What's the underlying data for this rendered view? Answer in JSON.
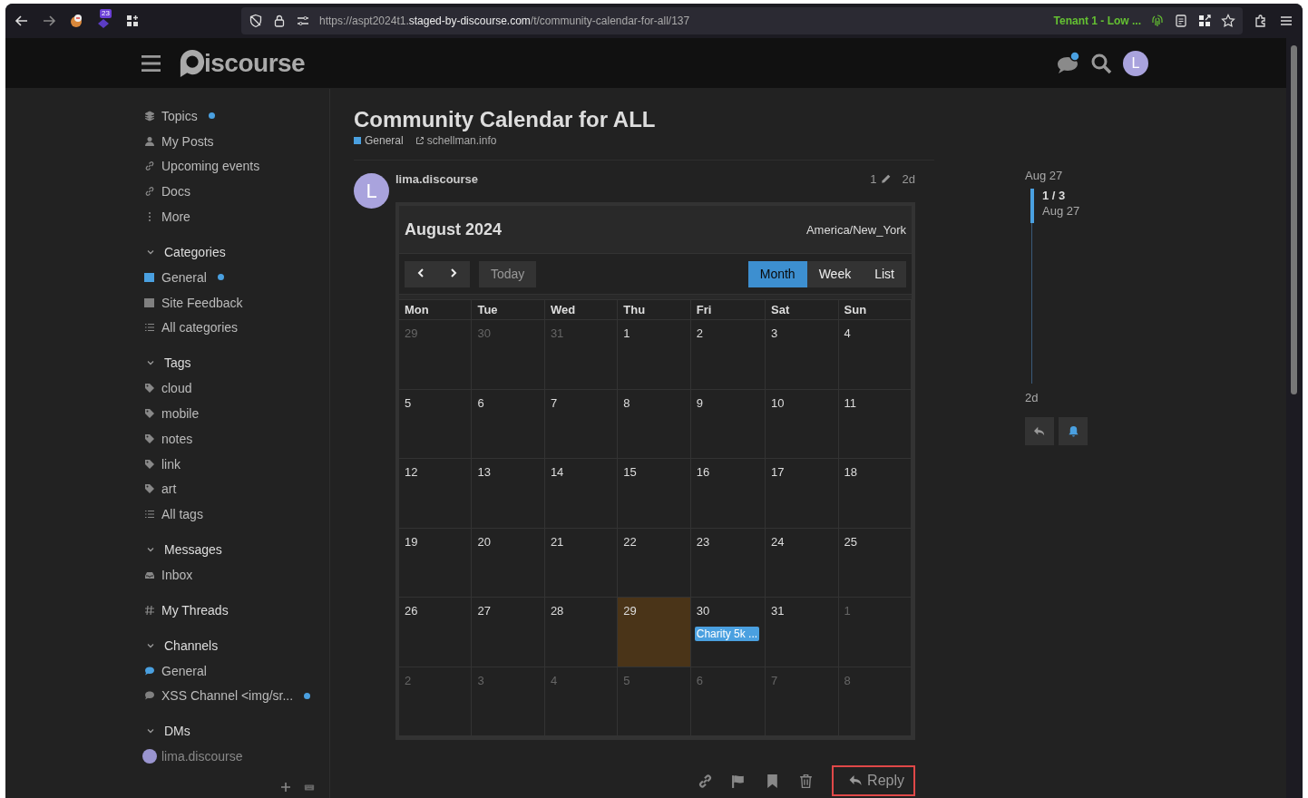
{
  "browser": {
    "url_start": "https://aspt2024t1.",
    "url_host": "staged-by-discourse.com",
    "url_path": "/t/community-calendar-for-all/137",
    "extension_badge": "23",
    "container_label": "Tenant 1 - Low ..."
  },
  "header": {
    "logo_text": "iscourse",
    "chat_unread": true,
    "avatar_letter": "L"
  },
  "sidebar": {
    "sections": [
      {
        "items": [
          {
            "label": "Topics",
            "kind": "layers",
            "unread": true
          },
          {
            "label": "My Posts",
            "kind": "user",
            "unread": false
          },
          {
            "label": "Upcoming events",
            "kind": "link",
            "unread": false
          },
          {
            "label": "Docs",
            "kind": "link",
            "unread": false
          },
          {
            "label": "More",
            "kind": "dots",
            "unread": false
          }
        ]
      },
      {
        "heading": "Categories",
        "expanded": true,
        "items": [
          {
            "label": "General",
            "kind": "category",
            "color": "#4aa0e0",
            "unread": true
          },
          {
            "label": "Site Feedback",
            "kind": "category",
            "color": "#808080",
            "unread": false
          },
          {
            "label": "All categories",
            "kind": "list",
            "unread": false
          }
        ]
      },
      {
        "heading": "Tags",
        "expanded": true,
        "items": [
          {
            "label": "cloud",
            "kind": "tag",
            "unread": false
          },
          {
            "label": "mobile",
            "kind": "tag",
            "unread": false
          },
          {
            "label": "notes",
            "kind": "tag",
            "unread": false
          },
          {
            "label": "link",
            "kind": "tag",
            "unread": false
          },
          {
            "label": "art",
            "kind": "tag",
            "unread": false
          },
          {
            "label": "All tags",
            "kind": "list",
            "unread": false
          }
        ]
      },
      {
        "heading": "Messages",
        "expanded": true,
        "items": [
          {
            "label": "Inbox",
            "kind": "inbox",
            "unread": false
          }
        ]
      },
      {
        "items": [
          {
            "label": "My Threads",
            "kind": "threads",
            "unread": false
          }
        ]
      },
      {
        "heading": "Channels",
        "expanded": true,
        "items": [
          {
            "label": "General",
            "kind": "channel",
            "color": "#4aa0e0",
            "unread": false
          },
          {
            "label": "XSS Channel <img/sr...",
            "kind": "channel",
            "color": "#808080",
            "unread": true
          }
        ]
      },
      {
        "heading": "DMs",
        "expanded": true,
        "items": [
          {
            "label": "lima.discourse",
            "kind": "dm",
            "unread": false
          }
        ]
      }
    ]
  },
  "topic": {
    "title": "Community Calendar for ALL",
    "category": "General",
    "link": "schellman.info"
  },
  "post": {
    "author": "lima.discourse",
    "avatar_letter": "L",
    "edits": "1",
    "age": "2d"
  },
  "calendar": {
    "title": "August 2024",
    "timezone": "America/New_York",
    "today_button": "Today",
    "views": [
      {
        "label": "Month",
        "selected": true
      },
      {
        "label": "Week",
        "selected": false
      },
      {
        "label": "List",
        "selected": false
      }
    ],
    "weekdays": [
      "Mon",
      "Tue",
      "Wed",
      "Thu",
      "Fri",
      "Sat",
      "Sun"
    ],
    "weeks": [
      [
        {
          "day": "29",
          "muted": true,
          "today": false
        },
        {
          "day": "30",
          "muted": true,
          "today": false
        },
        {
          "day": "31",
          "muted": true,
          "today": false
        },
        {
          "day": "1",
          "muted": false,
          "today": false
        },
        {
          "day": "2",
          "muted": false,
          "today": false
        },
        {
          "day": "3",
          "muted": false,
          "today": false
        },
        {
          "day": "4",
          "muted": false,
          "today": false
        }
      ],
      [
        {
          "day": "5",
          "muted": false,
          "today": false
        },
        {
          "day": "6",
          "muted": false,
          "today": false
        },
        {
          "day": "7",
          "muted": false,
          "today": false
        },
        {
          "day": "8",
          "muted": false,
          "today": false
        },
        {
          "day": "9",
          "muted": false,
          "today": false
        },
        {
          "day": "10",
          "muted": false,
          "today": false
        },
        {
          "day": "11",
          "muted": false,
          "today": false
        }
      ],
      [
        {
          "day": "12",
          "muted": false,
          "today": false
        },
        {
          "day": "13",
          "muted": false,
          "today": false
        },
        {
          "day": "14",
          "muted": false,
          "today": false
        },
        {
          "day": "15",
          "muted": false,
          "today": false
        },
        {
          "day": "16",
          "muted": false,
          "today": false
        },
        {
          "day": "17",
          "muted": false,
          "today": false
        },
        {
          "day": "18",
          "muted": false,
          "today": false
        }
      ],
      [
        {
          "day": "19",
          "muted": false,
          "today": false
        },
        {
          "day": "20",
          "muted": false,
          "today": false
        },
        {
          "day": "21",
          "muted": false,
          "today": false
        },
        {
          "day": "22",
          "muted": false,
          "today": false
        },
        {
          "day": "23",
          "muted": false,
          "today": false
        },
        {
          "day": "24",
          "muted": false,
          "today": false
        },
        {
          "day": "25",
          "muted": false,
          "today": false
        }
      ],
      [
        {
          "day": "26",
          "muted": false,
          "today": false
        },
        {
          "day": "27",
          "muted": false,
          "today": false
        },
        {
          "day": "28",
          "muted": false,
          "today": false
        },
        {
          "day": "29",
          "muted": false,
          "today": true
        },
        {
          "day": "30",
          "muted": false,
          "today": false,
          "events": [
            "Charity 5k ..."
          ]
        },
        {
          "day": "31",
          "muted": false,
          "today": false
        },
        {
          "day": "1",
          "muted": true,
          "today": false
        }
      ],
      [
        {
          "day": "2",
          "muted": true,
          "today": false
        },
        {
          "day": "3",
          "muted": true,
          "today": false
        },
        {
          "day": "4",
          "muted": true,
          "today": false
        },
        {
          "day": "5",
          "muted": true,
          "today": false
        },
        {
          "day": "6",
          "muted": true,
          "today": false
        },
        {
          "day": "7",
          "muted": true,
          "today": false
        },
        {
          "day": "8",
          "muted": true,
          "today": false
        }
      ]
    ]
  },
  "actions": {
    "reply": "Reply",
    "reply_outlined": true
  },
  "timeline": {
    "start": "Aug 27",
    "position": "1 / 3",
    "date": "Aug 27",
    "end": "2d"
  }
}
